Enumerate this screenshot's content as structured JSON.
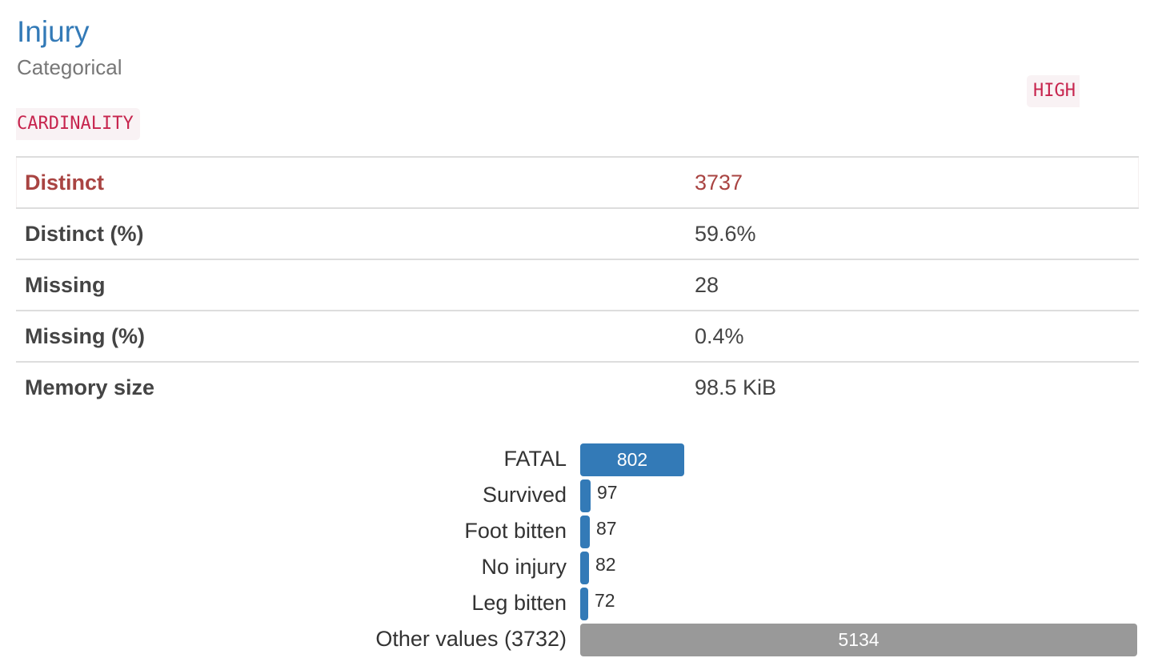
{
  "header": {
    "title": "Injury",
    "subtitle": "Categorical",
    "badge_line1": "HIGH",
    "badge_line2": "CARDINALITY"
  },
  "stats": [
    {
      "label": "Distinct",
      "value": "3737",
      "alert": true
    },
    {
      "label": "Distinct (%)",
      "value": "59.6%",
      "alert": false
    },
    {
      "label": "Missing",
      "value": "28",
      "alert": false
    },
    {
      "label": "Missing (%)",
      "value": "0.4%",
      "alert": false
    },
    {
      "label": "Memory size",
      "value": "98.5 KiB",
      "alert": false
    }
  ],
  "colors": {
    "accent": "#337ab7",
    "alert": "#a94442",
    "badge_text": "#c7254e",
    "badge_bg": "#f9f2f4",
    "other_bar": "#999999"
  },
  "chart_data": {
    "type": "bar",
    "orientation": "horizontal",
    "categories": [
      "FATAL",
      "Survived",
      "Foot bitten",
      "No injury",
      "Leg bitten",
      "Other values (3732)"
    ],
    "values": [
      802,
      97,
      87,
      82,
      72,
      5134
    ],
    "count_labels": [
      "802",
      "97",
      "87",
      "82",
      "72",
      "5134"
    ],
    "xlim": [
      0,
      5134
    ]
  }
}
